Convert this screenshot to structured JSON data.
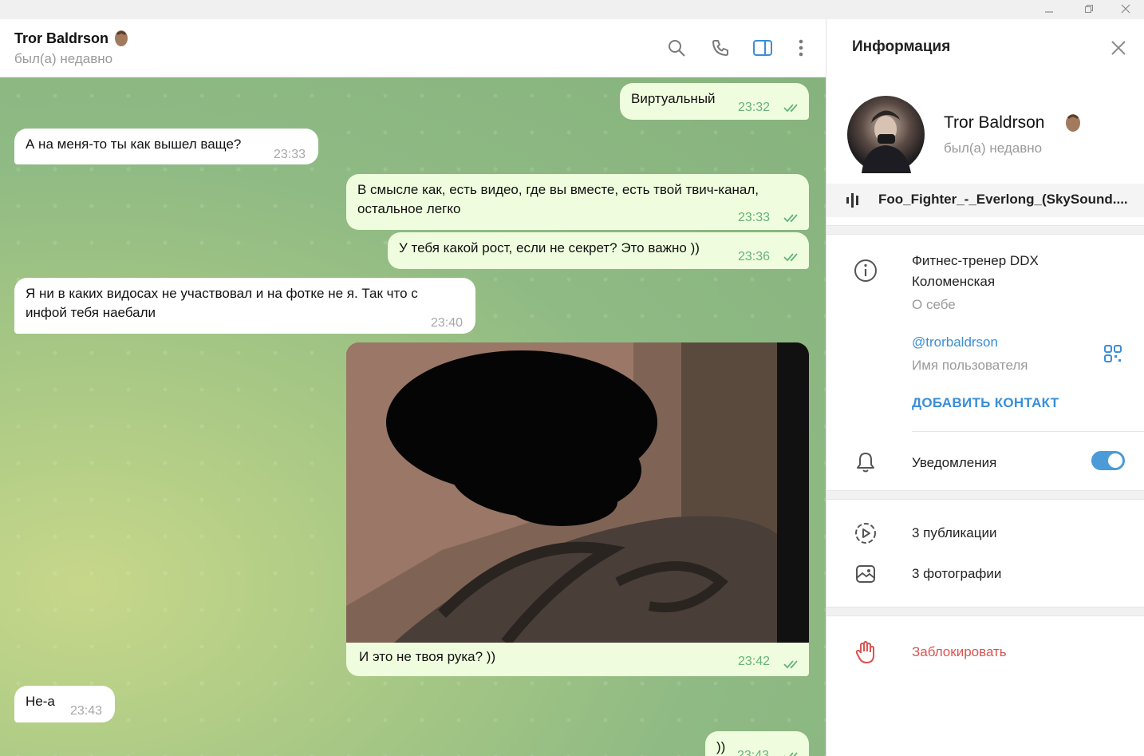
{
  "colors": {
    "accent": "#3a8ed6",
    "outgoing_bubble": "#effdde",
    "danger": "#d9534f",
    "time_out": "#68b27a"
  },
  "header": {
    "name": "Tror Baldrson",
    "status": "был(а) недавно"
  },
  "messages": {
    "m1": {
      "text": "Виртуальный",
      "time": "23:32"
    },
    "m2": {
      "text": "А на меня-то ты как вышел ваще?",
      "time": "23:33"
    },
    "m3": {
      "line1": "В смысле как, есть видео, где вы вместе, есть твой твич-канал,",
      "line2": "остальное легко",
      "time": "23:33"
    },
    "m4": {
      "text": "У тебя какой рост, если не секрет? Это важно ))",
      "time": "23:36"
    },
    "m5": {
      "line1": "Я ни в каких видосах не участвовал и на фотке не я. Так что с",
      "line2": "инфой тебя наебали",
      "time": "23:40"
    },
    "m6": {
      "caption": "И это не твоя рука? ))",
      "time": "23:42"
    },
    "m7": {
      "text": "Не-а",
      "time": "23:43"
    },
    "m8": {
      "text": "))",
      "time": "23:43"
    }
  },
  "info_panel": {
    "title": "Информация",
    "name": "Tror Baldrson",
    "status": "был(а) недавно",
    "music": "Foo_Fighter_-_Everlong_(SkySound....",
    "bio_line1": "Фитнес-тренер DDX",
    "bio_line2": "Коломенская",
    "bio_label": "О себе",
    "username": "@trorbaldrson",
    "username_label": "Имя пользователя",
    "add_contact": "ДОБАВИТЬ КОНТАКТ",
    "notifications": "Уведомления",
    "notifications_on": true,
    "posts": "3 публикации",
    "photos": "3 фотографии",
    "block": "Заблокировать"
  }
}
